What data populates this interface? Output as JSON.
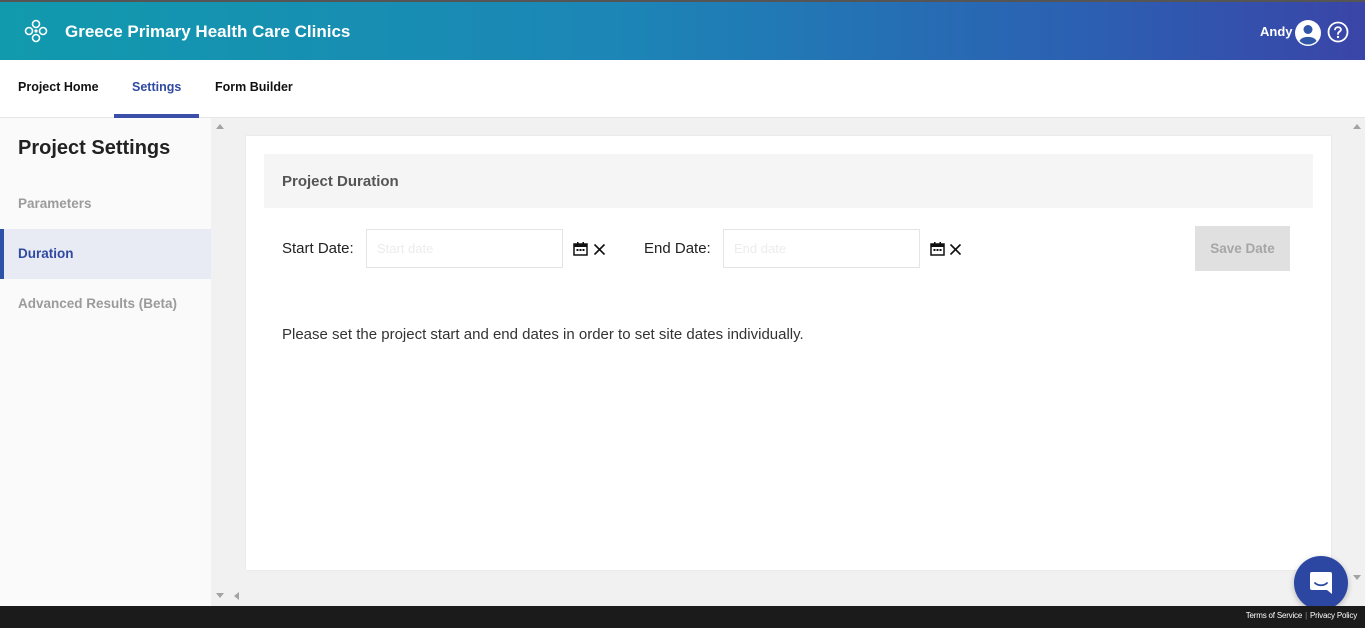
{
  "header": {
    "app_title": "Greece Primary Health Care Clinics",
    "user_name": "Andy"
  },
  "tabs": [
    {
      "label": "Project Home",
      "active": false
    },
    {
      "label": "Settings",
      "active": true
    },
    {
      "label": "Form Builder",
      "active": false
    }
  ],
  "sidebar": {
    "title": "Project Settings",
    "items": [
      {
        "label": "Parameters",
        "active": false
      },
      {
        "label": "Duration",
        "active": true
      },
      {
        "label": "Advanced Results (Beta)",
        "active": false
      }
    ]
  },
  "duration": {
    "section_title": "Project Duration",
    "start_label": "Start Date:",
    "start_value": "",
    "start_placeholder": "Start date",
    "end_label": "End Date:",
    "end_value": "",
    "end_placeholder": "End date",
    "save_label": "Save Date",
    "message": "Please set the project start and end dates in order to set site dates individually."
  },
  "footer": {
    "terms": "Terms of Service",
    "privacy": "Privacy Policy"
  },
  "colors": {
    "accent": "#3b4ea8",
    "header_start": "#119aad",
    "header_end": "#3a45a8",
    "chat_button": "#2c47a2"
  },
  "icons": [
    "logo-icon",
    "user-avatar-icon",
    "help-icon",
    "calendar-icon",
    "clear-icon",
    "chat-icon"
  ]
}
